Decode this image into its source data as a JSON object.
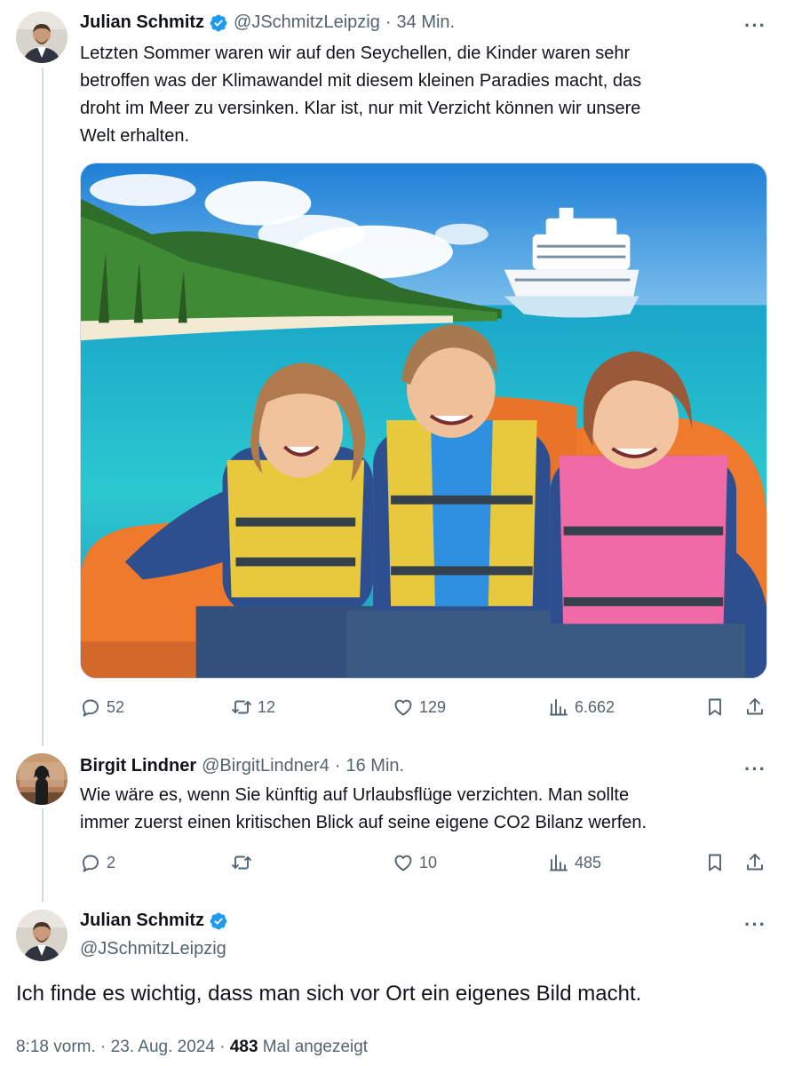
{
  "tweet1": {
    "name": "Julian Schmitz",
    "handle": "@JSchmitzLeipzig",
    "time": "34 Min.",
    "text_lines": [
      "Letzten Sommer waren wir auf den Seychellen, die Kinder waren sehr",
      "betroffen was der Klimawandel mit diesem kleinen Paradies macht, das",
      "droht im Meer zu versinken. Klar ist, nur mit Verzicht können wir unsere",
      "Welt erhalten."
    ],
    "stats": {
      "replies": "52",
      "reposts": "12",
      "likes": "129",
      "views": "6.662"
    }
  },
  "tweet2": {
    "name": "Birgit Lindner",
    "handle": "@BirgitLindner4",
    "time": "16 Min.",
    "text_lines": [
      "Wie wäre es, wenn Sie künftig auf Urlaubsflüge verzichten. Man sollte",
      "immer zuerst einen kritischen Blick auf seine eigene CO2 Bilanz werfen."
    ],
    "stats": {
      "replies": "2",
      "reposts": "",
      "likes": "10",
      "views": "485"
    }
  },
  "tweet3": {
    "name": "Julian Schmitz",
    "handle": "@JSchmitzLeipzig",
    "text": "Ich finde es wichtig, dass man sich vor Ort ein eigenes Bild macht.",
    "timestamp": "8:18 vorm. · 23. Aug. 2024 · ",
    "views": "483",
    "views_label": " Mal angezeigt"
  },
  "separator": "·",
  "more_label": "···",
  "icons": [
    "verified-badge-icon",
    "reply-icon",
    "repost-icon",
    "like-icon",
    "views-icon",
    "bookmark-icon",
    "share-icon",
    "more-icon"
  ],
  "colors": {
    "verified": "#1d9bf0",
    "muted": "#536471",
    "text": "#0f1419",
    "thread_line": "#cfd9de"
  }
}
